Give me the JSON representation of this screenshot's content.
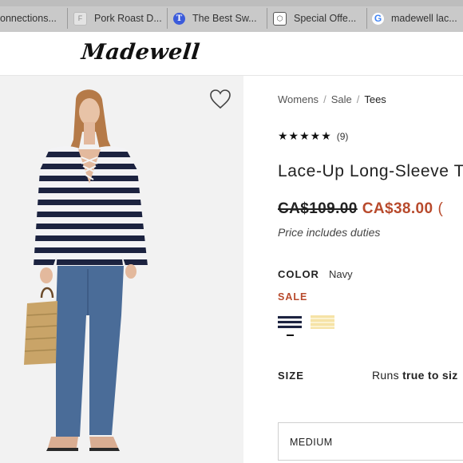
{
  "browser": {
    "tabs": [
      {
        "label": "onnections...",
        "icon": "none"
      },
      {
        "label": "Pork Roast D...",
        "icon": "letter-f-favicon",
        "favicon_letter": "F"
      },
      {
        "label": "The Best Sw...",
        "icon": "nyt-favicon",
        "favicon_letter": "T"
      },
      {
        "label": "Special Offe...",
        "icon": "shield-favicon",
        "favicon_letter": "⬡"
      },
      {
        "label": "madewell lac...",
        "icon": "google-favicon",
        "favicon_letter": "G"
      }
    ]
  },
  "header": {
    "logo_text": "Madewell"
  },
  "product_image": {
    "alt": "model",
    "favorite_icon": "heart-icon"
  },
  "breadcrumb": {
    "items": [
      "Womens",
      "Sale",
      "Tees"
    ],
    "separator": "/"
  },
  "rating": {
    "stars": 5,
    "star_glyphs": "★★★★★",
    "review_count": "(9)"
  },
  "product": {
    "title": "Lace-Up Long-Sleeve T",
    "price_original": "CA$109.00",
    "price_sale": "CA$38.00",
    "price_extra": "(",
    "duties_note": "Price includes duties"
  },
  "color": {
    "label": "COLOR",
    "value": "Navy",
    "sale_label": "SALE",
    "swatches": [
      {
        "name": "navy-stripe",
        "selected": true
      },
      {
        "name": "yellow-stripe",
        "selected": false
      }
    ]
  },
  "size": {
    "label": "SIZE",
    "fit_prefix": "Runs ",
    "fit_bold": "true to siz",
    "selected": "MEDIUM"
  },
  "colors": {
    "sale": "#b84a2c",
    "navy": "#1c2340",
    "tab_bar": "#c9c9c9"
  }
}
